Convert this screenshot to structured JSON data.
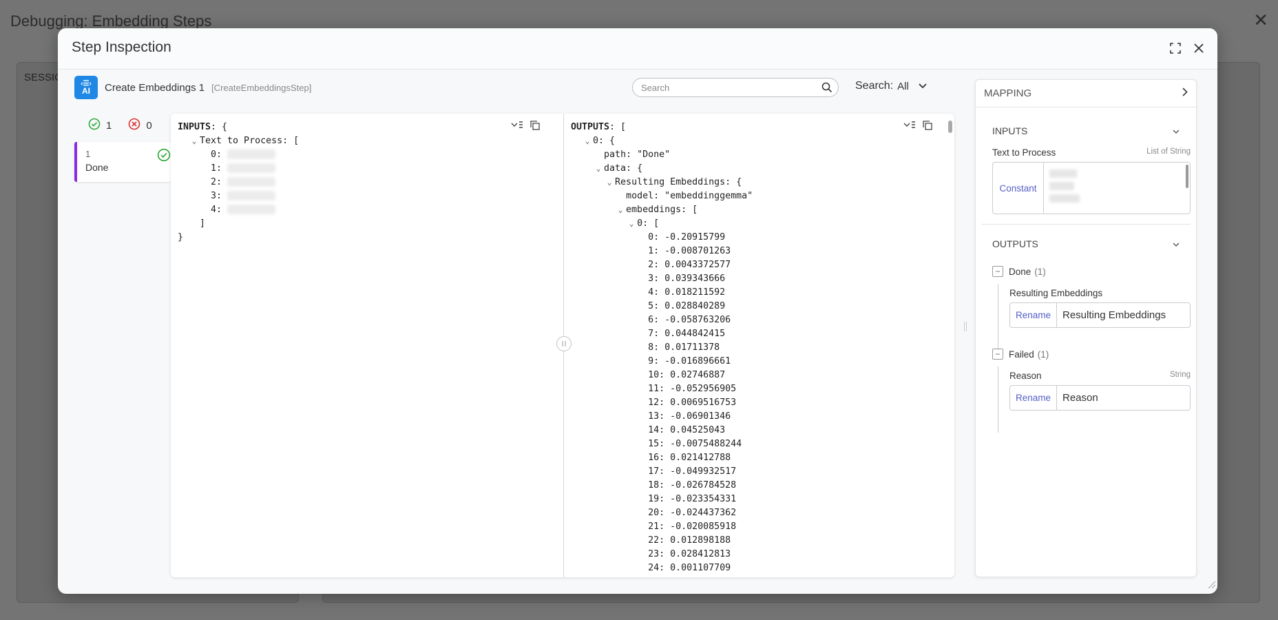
{
  "background": {
    "title": "Debugging: Embedding Steps",
    "sessions_label": "SESSIO"
  },
  "modal": {
    "title": "Step Inspection"
  },
  "step": {
    "name": "Create Embeddings 1",
    "type": "[CreateEmbeddingsStep]",
    "icon_text": "AI"
  },
  "search": {
    "placeholder": "Search",
    "mode_label": "Search:",
    "mode_value": "All"
  },
  "counters": {
    "passed": "1",
    "failed": "0"
  },
  "paths": [
    {
      "num": "1",
      "name": "Done"
    }
  ],
  "inputs_json": {
    "root_key": "INPUTS",
    "root_open": ": {",
    "field_key": "Text to Process",
    "field_open": ": [",
    "indices": [
      "0:",
      "1:",
      "2:",
      "3:",
      "4:"
    ],
    "close_bracket": "]",
    "close_brace": "}"
  },
  "outputs_json": {
    "root_key": "OUTPUTS",
    "root_open": ": [",
    "item0": "0: {",
    "path_line": "path: \"Done\"",
    "data_line": "data: {",
    "resulting_line": "Resulting Embeddings: {",
    "model_line": "model: \"embeddinggemma\"",
    "embeddings_line": "embeddings: [",
    "emb0_line": "0: [",
    "values": [
      "0: -0.20915799",
      "1: -0.008701263",
      "2: 0.0043372577",
      "3: 0.039343666",
      "4: 0.018211592",
      "5: 0.028840289",
      "6: -0.058763206",
      "7: 0.044842415",
      "8: 0.01711378",
      "9: -0.016896661",
      "10: 0.02746887",
      "11: -0.052956905",
      "12: 0.0069516753",
      "13: -0.06901346",
      "14: 0.04525043",
      "15: -0.0075488244",
      "16: 0.021412788",
      "17: -0.049932517",
      "18: -0.026784528",
      "19: -0.023354331",
      "20: -0.024437362",
      "21: -0.020085918",
      "22: 0.012898188",
      "23: 0.028412813",
      "24: 0.001107709"
    ]
  },
  "mapping": {
    "title": "MAPPING",
    "inputs_label": "INPUTS",
    "input_field": "Text to Process",
    "input_type": "List of String",
    "constant_label": "Constant",
    "outputs_label": "OUTPUTS",
    "groups": [
      {
        "name": "Done",
        "count": "(1)",
        "field": "Resulting Embeddings",
        "field_type": "",
        "rename_label": "Rename",
        "rename_value": "Resulting Embeddings"
      },
      {
        "name": "Failed",
        "count": "(1)",
        "field": "Reason",
        "field_type": "String",
        "rename_label": "Rename",
        "rename_value": "Reason"
      }
    ]
  },
  "colors": {
    "accent": "#5560c7",
    "path_border": "#8a2be2",
    "success": "#2eaa3a",
    "error": "#d93030",
    "ai_icon": "#1f88e5"
  }
}
